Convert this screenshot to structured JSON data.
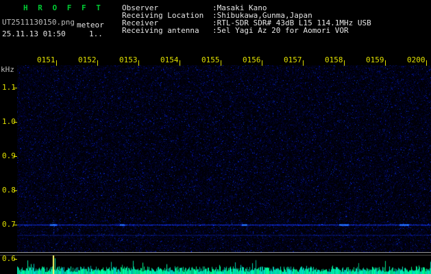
{
  "colors": {
    "title_green": "#00cc33",
    "axis_yellow": "#e0e000",
    "text_white": "#e6e6e6",
    "filename_gray": "#bdbdbd",
    "carrier_blue": "#3c64ff",
    "level_cyan": "#00dca0",
    "spike_yellow": "#ffff66",
    "separator_gray": "#9a9a9a"
  },
  "header": {
    "app_title": "H R O F F T",
    "filename": "UT2511130150.png",
    "mode_label": "meteor",
    "datetime": "25.11.13 01:50",
    "counter": "1..",
    "info": [
      {
        "label": "Observer",
        "value": ":Masaki Kano"
      },
      {
        "label": "Receiving Location",
        "value": ":Shibukawa,Gunma,Japan"
      },
      {
        "label": "Receiver",
        "value": ":RTL-SDR SDR# 43dB L15 114.1MHz USB"
      },
      {
        "label": "Receiving antenna",
        "value": ":5el Yagi Az 20 for Aomori VOR"
      }
    ]
  },
  "chart_data": {
    "type": "heatmap",
    "description": "HROFFT radio meteor observation spectrogram: 10-minute waterfall of received audio spectrum (frequency vs UT time, intensity as blue brightness) with signal-level strip along the bottom",
    "ylabel": "kHz",
    "x_tick_labels": [
      "0151",
      "0152",
      "0153",
      "0154",
      "0155",
      "0156",
      "0157",
      "0158",
      "0159",
      "0200"
    ],
    "y_tick_labels": [
      "1.1",
      "1.0",
      "0.9",
      "0.8",
      "0.7",
      "0.6"
    ],
    "x_range_ut": [
      "0150",
      "0200"
    ],
    "ylim_khz": [
      0.6,
      1.15
    ],
    "carrier_lines_khz": [
      0.7,
      0.67
    ],
    "level_spike_at": "0151"
  }
}
